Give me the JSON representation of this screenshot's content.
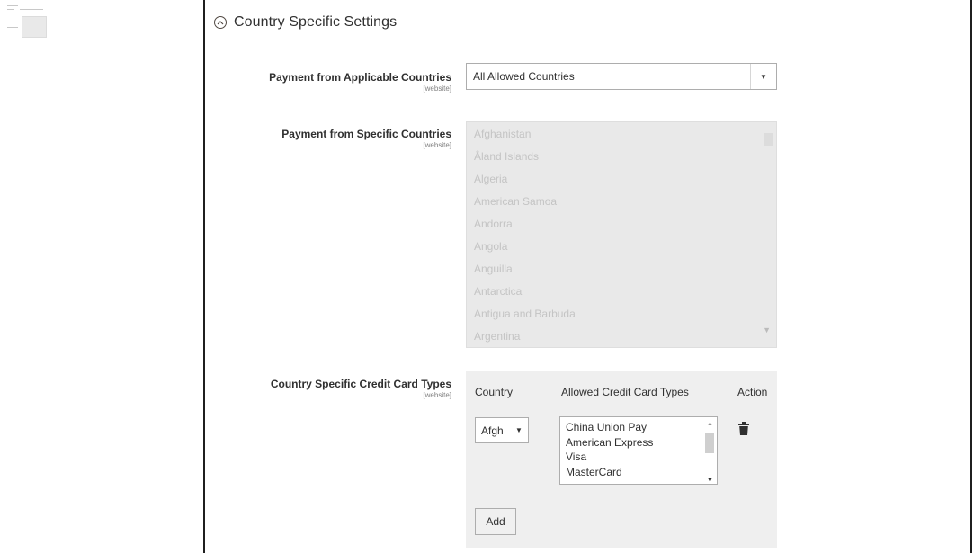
{
  "section": {
    "title": "Country Specific Settings"
  },
  "fields": {
    "applicable": {
      "label": "Payment from Applicable Countries",
      "scope": "[website]",
      "value": "All Allowed Countries"
    },
    "specific": {
      "label": "Payment from Specific Countries",
      "scope": "[website]",
      "options": [
        "Afghanistan",
        "Åland Islands",
        "Algeria",
        "American Samoa",
        "Andorra",
        "Angola",
        "Anguilla",
        "Antarctica",
        "Antigua and Barbuda",
        "Argentina"
      ]
    },
    "cc_types": {
      "label": "Country Specific Credit Card Types",
      "scope": "[website]",
      "headers": {
        "country": "Country",
        "allowed": "Allowed Credit Card Types",
        "action": "Action"
      },
      "country_value": "Afgh",
      "cards": [
        "China Union Pay",
        "American Express",
        "Visa",
        "MasterCard"
      ],
      "add_label": "Add"
    }
  },
  "icons": {
    "collapse": "collapse-circle-icon",
    "delete": "trash-icon"
  }
}
